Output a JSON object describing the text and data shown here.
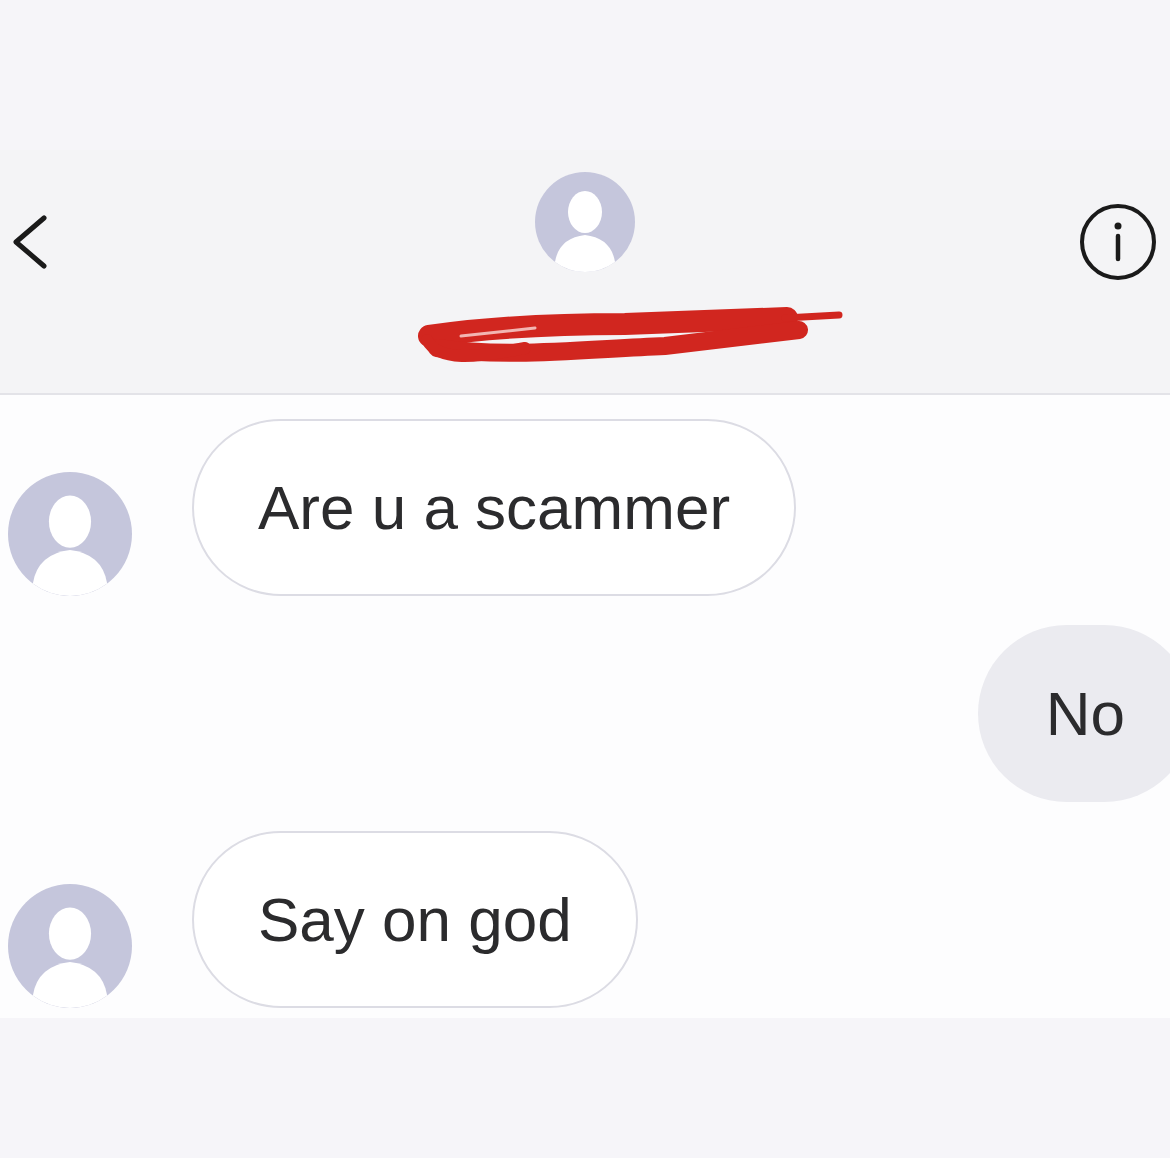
{
  "conversation": {
    "contact": {
      "redacted": true
    }
  },
  "messages": [
    {
      "kind": "received",
      "text": "Are u a scammer"
    },
    {
      "kind": "sent",
      "text": "No"
    },
    {
      "kind": "received",
      "text": "Say on god"
    }
  ]
}
